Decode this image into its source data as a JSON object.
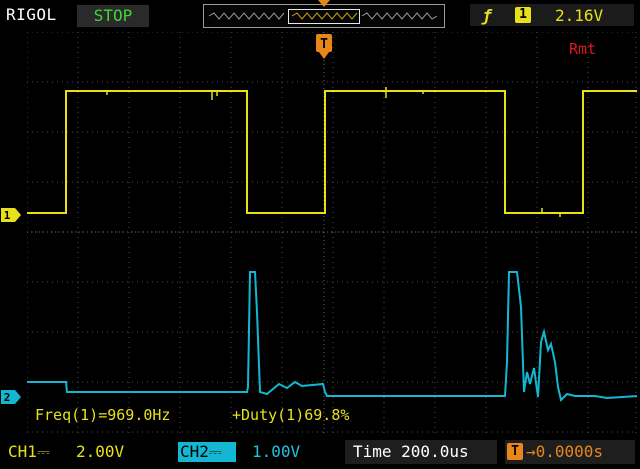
{
  "header": {
    "brand": "RIGOL",
    "run_status": "STOP",
    "remote": "Rmt"
  },
  "trigger": {
    "edge_icon": "rising-edge-icon",
    "source": "1",
    "level": "2.16V",
    "marker_label": "T"
  },
  "channels": {
    "ch1": {
      "marker": "1",
      "label": "CH1⎓",
      "scale": "2.00V",
      "color": "#e8e11a"
    },
    "ch2": {
      "marker": "2",
      "label": "CH2⎓",
      "scale": "1.00V",
      "color": "#14b7d2"
    }
  },
  "measurements": {
    "freq": "Freq(1)=969.0Hz",
    "duty": "+Duty(1)69.8%"
  },
  "timebase": {
    "time": "Time 200.0us",
    "offset": "→0.0000s"
  },
  "colors": {
    "grid": "#3a3a3a",
    "ch1": "#e8e11a",
    "ch2": "#14b7d2",
    "trigger": "#e7871a",
    "remote": "#d61c1c",
    "status": "#41d63b"
  }
}
